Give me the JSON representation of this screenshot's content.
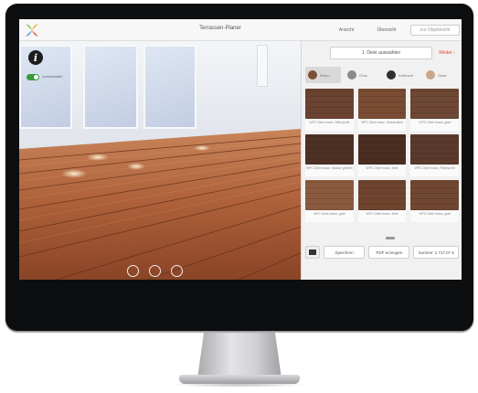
{
  "header": {
    "title": "Terrassen-Planer",
    "nav": [
      "Ansicht",
      "Übersicht",
      "zur Objektsicht"
    ]
  },
  "viewport": {
    "toggle_label": "Lichtschalter",
    "info_glyph": "i"
  },
  "panel": {
    "step_label": "1. Diele auswählen",
    "next_label": "Weiter ›",
    "color_tabs": [
      {
        "label": "Braun",
        "color": "#7a4f35"
      },
      {
        "label": "Grau",
        "color": "#8a8a8a"
      },
      {
        "label": "Anthrazit",
        "color": "#2f2f33"
      },
      {
        "label": "Sand",
        "color": "#c9a58a"
      }
    ],
    "products": [
      {
        "label": "WPC Diele braun, Rillenprofil",
        "color": "#6b4330"
      },
      {
        "label": "WPC Diele braun, Massivdiele",
        "color": "#7a4c33"
      },
      {
        "label": "WPC Diele braun, glatt",
        "color": "#6d4835"
      },
      {
        "label": "WPC Diele braun, Massiv geriffelt",
        "color": "#4f3024"
      },
      {
        "label": "WPC Diele braun, breit",
        "color": "#4a2e22"
      },
      {
        "label": "WPC Diele braun, Rillenprofil",
        "color": "#5a3a2c"
      },
      {
        "label": "WPC Diele braun, glatt",
        "color": "#8b5a3e"
      },
      {
        "label": "WPC Diele braun, breit",
        "color": "#6e452f"
      },
      {
        "label": "WPC Diele braun, glatt",
        "color": "#704832"
      },
      {
        "label": "",
        "color": "#5d3a29"
      },
      {
        "label": "",
        "color": "#76503a"
      },
      {
        "label": "",
        "color": "#6a4331"
      }
    ],
    "buttons": {
      "save": "Speichern",
      "pdf": "PDF erzeugen",
      "sum": "Summe: 1.717,07 €"
    }
  }
}
